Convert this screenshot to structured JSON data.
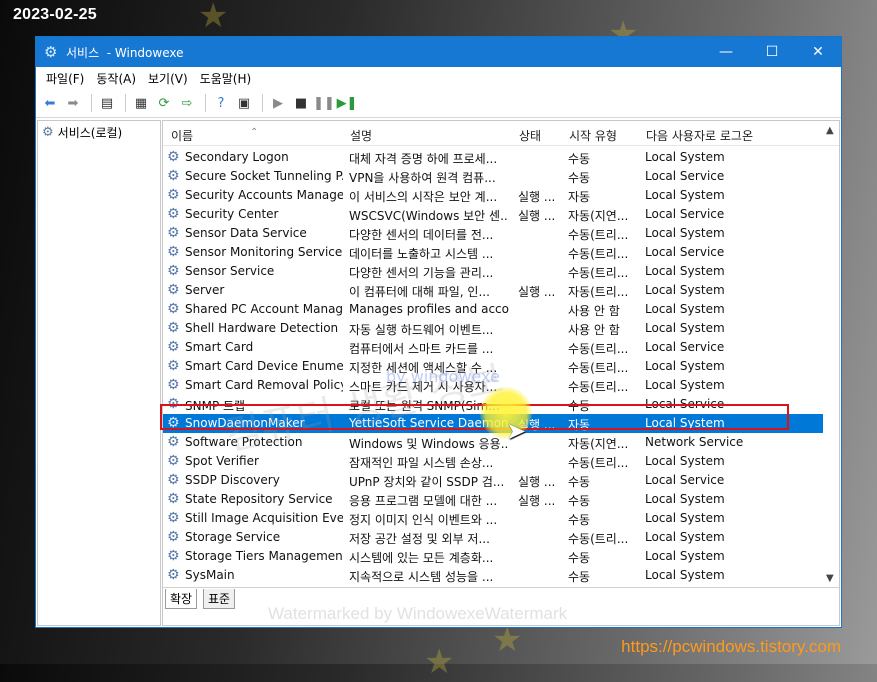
{
  "overlay": {
    "date": "2023-02-25",
    "watermark_center": "컴퓨터 생활 정보",
    "watermark_by": "by windowexe",
    "watermark_bottom": "Watermarked by WindowexeWatermark",
    "site_url": "https://pcwindows.tistory.com"
  },
  "window": {
    "title": "서비스  - Windowexe",
    "controls": {
      "minimize": "—",
      "maximize": "☐",
      "close": "✕"
    }
  },
  "menu": [
    "파일(F)",
    "동작(A)",
    "보기(V)",
    "도움말(H)"
  ],
  "left_pane": {
    "root_label": "서비스(로컬)"
  },
  "columns": {
    "name": "이름",
    "desc": "설명",
    "status": "상태",
    "startup": "시작 유형",
    "logon": "다음 사용자로 로그온"
  },
  "services": [
    {
      "name": "Secondary Logon",
      "desc": "대체 자격 증명 하에 프로세...",
      "status": "",
      "startup": "수동",
      "logon": "Local System"
    },
    {
      "name": "Secure Socket Tunneling P...",
      "desc": "VPN을 사용하여 원격 컴퓨...",
      "status": "",
      "startup": "수동",
      "logon": "Local Service"
    },
    {
      "name": "Security Accounts Manager",
      "desc": "이 서비스의 시작은 보안 계...",
      "status": "실행 ...",
      "startup": "자동",
      "logon": "Local System"
    },
    {
      "name": "Security Center",
      "desc": "WSCSVC(Windows 보안 센...",
      "status": "실행 ...",
      "startup": "자동(지연...",
      "logon": "Local Service"
    },
    {
      "name": "Sensor Data Service",
      "desc": "다양한 센서의 데이터를 전...",
      "status": "",
      "startup": "수동(트리...",
      "logon": "Local System"
    },
    {
      "name": "Sensor Monitoring Service",
      "desc": "데이터를 노출하고 시스템 ...",
      "status": "",
      "startup": "수동(트리...",
      "logon": "Local Service"
    },
    {
      "name": "Sensor Service",
      "desc": "다양한 센서의 기능을 관리...",
      "status": "",
      "startup": "수동(트리...",
      "logon": "Local System"
    },
    {
      "name": "Server",
      "desc": "이 컴퓨터에 대해 파일, 인...",
      "status": "실행 ...",
      "startup": "자동(트리...",
      "logon": "Local System"
    },
    {
      "name": "Shared PC Account Manager",
      "desc": "Manages profiles and acco...",
      "status": "",
      "startup": "사용 안 함",
      "logon": "Local System"
    },
    {
      "name": "Shell Hardware Detection",
      "desc": "자동 실행 하드웨어 이벤트...",
      "status": "",
      "startup": "사용 안 함",
      "logon": "Local System"
    },
    {
      "name": "Smart Card",
      "desc": "컴퓨터에서 스마트 카드를 ...",
      "status": "",
      "startup": "수동(트리...",
      "logon": "Local Service"
    },
    {
      "name": "Smart Card Device Enumer...",
      "desc": "지정한 세션에 액세스할 수 ...",
      "status": "",
      "startup": "수동(트리...",
      "logon": "Local System"
    },
    {
      "name": "Smart Card Removal Policy",
      "desc": "스마트 카드 제거 시 사용자...",
      "status": "",
      "startup": "수동(트리...",
      "logon": "Local System"
    },
    {
      "name": "SNMP 트랩",
      "desc": "로컬 또는 원격 SNMP(Sim...",
      "status": "",
      "startup": "수동",
      "logon": "Local Service"
    },
    {
      "name": "SnowDaemonMaker",
      "desc": "YettieSoft Service Daemon",
      "status": "실행 ...",
      "startup": "자동",
      "logon": "Local System"
    },
    {
      "name": "Software Protection",
      "desc": "Windows 및 Windows 응용...",
      "status": "",
      "startup": "자동(지연...",
      "logon": "Network Service"
    },
    {
      "name": "Spot Verifier",
      "desc": "잠재적인 파일 시스템 손상...",
      "status": "",
      "startup": "수동(트리...",
      "logon": "Local System"
    },
    {
      "name": "SSDP Discovery",
      "desc": "UPnP 장치와 같이 SSDP 검...",
      "status": "실행 ...",
      "startup": "수동",
      "logon": "Local Service"
    },
    {
      "name": "State Repository Service",
      "desc": "응용 프로그램 모델에 대한 ...",
      "status": "실행 ...",
      "startup": "수동",
      "logon": "Local System"
    },
    {
      "name": "Still Image Acquisition Eve...",
      "desc": "정지 이미지 인식 이벤트와 ...",
      "status": "",
      "startup": "수동",
      "logon": "Local System"
    },
    {
      "name": "Storage Service",
      "desc": "저장 공간 설정 및 외부 저...",
      "status": "",
      "startup": "수동(트리...",
      "logon": "Local System"
    },
    {
      "name": "Storage Tiers Management",
      "desc": "시스템에 있는 모든 계층화...",
      "status": "",
      "startup": "수동",
      "logon": "Local System"
    },
    {
      "name": "SysMain",
      "desc": "지속적으로 시스템 성능을 ...",
      "status": "",
      "startup": "수동",
      "logon": "Local System"
    }
  ],
  "selected_service": "SnowDaemonMaker",
  "tabs": [
    "확장",
    "표준"
  ],
  "colors": {
    "titlebar": "#1778d4",
    "selection": "#0078d7",
    "highlight_box": "#d8141a",
    "url": "#ff9a1c"
  }
}
